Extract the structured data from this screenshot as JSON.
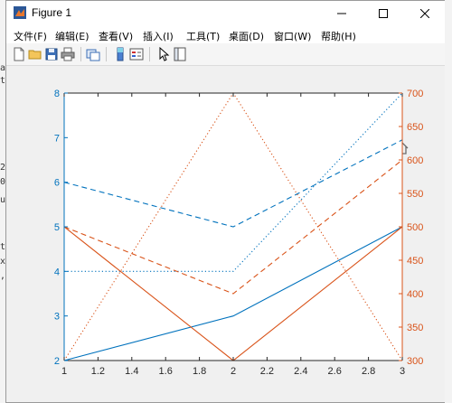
{
  "window": {
    "title": "Figure 1",
    "minimize_glyph": "—",
    "maximize_glyph": "☐",
    "close_glyph": "✕"
  },
  "menu": [
    {
      "label": "文件(F)"
    },
    {
      "label": "编辑(E)"
    },
    {
      "label": "查看(V)"
    },
    {
      "label": "插入(I)"
    },
    {
      "label": "工具(T)"
    },
    {
      "label": "桌面(D)"
    },
    {
      "label": "窗口(W)"
    },
    {
      "label": "帮助(H)"
    }
  ],
  "toolbar_icons": [
    "new-figure-icon",
    "open-file-icon",
    "save-icon",
    "print-icon",
    "link-plot-icon",
    "insert-colorbar-icon",
    "insert-legend-icon",
    "edit-plot-arrow-icon",
    "property-inspector-icon"
  ],
  "axes_toolbar_icons": [
    "brush-icon",
    "data-tips-icon",
    "pan-icon",
    "zoom-in-icon",
    "zoom-out-icon",
    "home-icon"
  ],
  "background_text": [
    "a",
    "ts",
    "2",
    "0",
    "u",
    "t",
    "x",
    ","
  ],
  "colors": {
    "left_axis": "#0072bd",
    "right_axis": "#d95319"
  },
  "chart_data": {
    "type": "line",
    "xlim": [
      1,
      3
    ],
    "x_ticks": [
      "1",
      "1.2",
      "1.4",
      "1.6",
      "1.8",
      "2",
      "2.2",
      "2.4",
      "2.6",
      "2.8",
      "3"
    ],
    "left_axis": {
      "ylim": [
        2,
        8
      ],
      "ticks": [
        "2",
        "3",
        "4",
        "5",
        "6",
        "7",
        "8"
      ],
      "color": "#0072bd",
      "series": [
        {
          "style": "solid",
          "x": [
            1,
            2,
            3
          ],
          "y": [
            2,
            3,
            5
          ]
        },
        {
          "style": "dashed",
          "x": [
            1,
            2,
            3
          ],
          "y": [
            6,
            5,
            6.95
          ]
        },
        {
          "style": "dotted",
          "x": [
            1,
            2,
            3
          ],
          "y": [
            4,
            4,
            8
          ]
        }
      ]
    },
    "right_axis": {
      "ylim": [
        300,
        700
      ],
      "ticks": [
        "300",
        "350",
        "400",
        "450",
        "500",
        "550",
        "600",
        "650",
        "700"
      ],
      "color": "#d95319",
      "series": [
        {
          "style": "solid",
          "x": [
            1,
            2,
            3
          ],
          "y": [
            500,
            300,
            500
          ]
        },
        {
          "style": "dashed",
          "x": [
            1,
            2,
            3
          ],
          "y": [
            500,
            400,
            600
          ]
        },
        {
          "style": "dotted",
          "x": [
            1,
            2,
            3
          ],
          "y": [
            300,
            700,
            300
          ]
        }
      ]
    },
    "grid": false
  }
}
